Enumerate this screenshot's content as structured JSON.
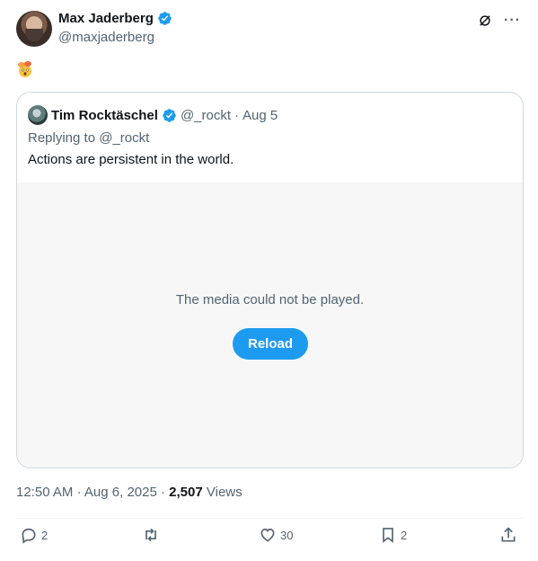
{
  "author": {
    "name": "Max Jaderberg",
    "handle": "@maxjaderberg"
  },
  "post_emoji": "🤯",
  "quoted": {
    "name": "Tim Rocktäschel",
    "handle": "@_rockt",
    "separator": "·",
    "date": "Aug 5",
    "reply_context": "Replying to @_rockt",
    "text": "Actions are persistent in the world.",
    "media_message": "The media could not be played.",
    "reload_label": "Reload"
  },
  "meta": {
    "time": "12:50 AM",
    "date": "Aug 6, 2025",
    "views_count": "2,507",
    "views_label": "Views"
  },
  "actions": {
    "replies": "2",
    "likes": "30",
    "bookmarks": "2"
  },
  "colors": {
    "accent": "#1d9bf0",
    "secondary_text": "#536471",
    "border": "#cfd9de",
    "media_bg": "#f7f7f8"
  },
  "icons": [
    "verified-badge-icon",
    "grok-icon",
    "more-icon",
    "reply-icon",
    "retweet-icon",
    "like-icon",
    "bookmark-icon",
    "share-icon"
  ]
}
